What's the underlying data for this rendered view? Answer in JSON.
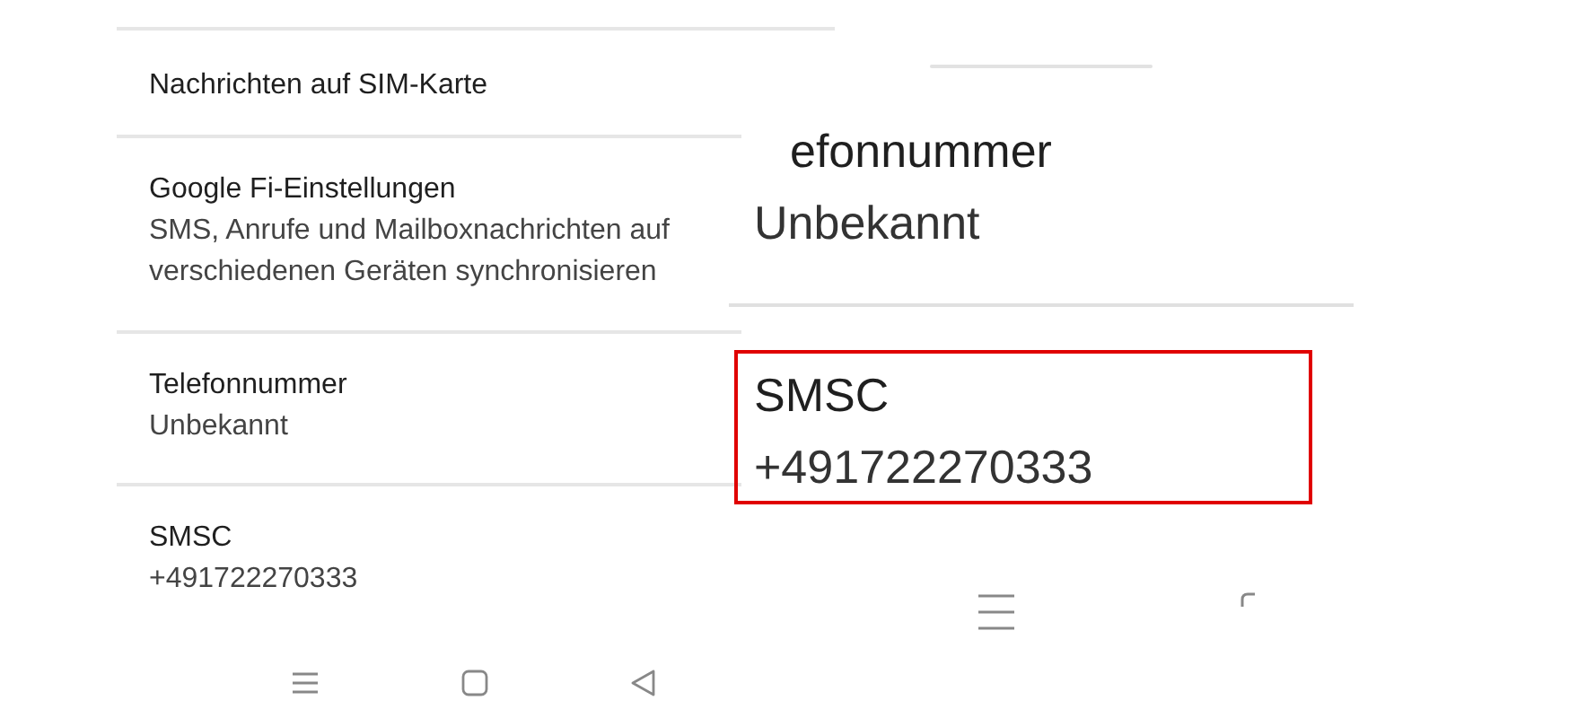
{
  "settings_items": [
    {
      "title": "Nachrichten auf SIM-Karte"
    },
    {
      "title": "Google Fi-Einstellungen",
      "subtitle": "SMS, Anrufe und Mailboxnachrichten auf verschiedenen Geräten synchronisieren"
    },
    {
      "title": "Telefonnummer",
      "subtitle": "Unbekannt"
    },
    {
      "title": "SMSC",
      "subtitle": "+491722270333"
    }
  ],
  "zoom_inset": {
    "items": [
      {
        "title": "efonnummer",
        "subtitle": "Unbekannt",
        "highlighted": false
      },
      {
        "title": "SMSC",
        "subtitle": "+491722270333",
        "highlighted": true
      }
    ]
  }
}
